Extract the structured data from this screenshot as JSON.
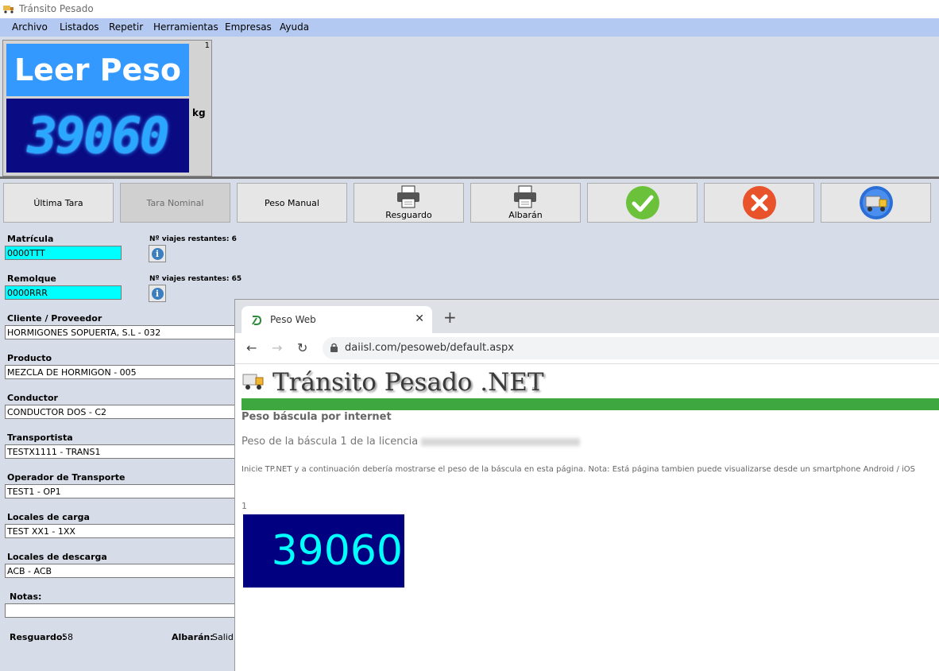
{
  "window": {
    "title": "Tránsito Pesado"
  },
  "menu": [
    "Archivo",
    "Listados",
    "Repetir",
    "Herramientas",
    "Empresas",
    "Ayuda"
  ],
  "scale": {
    "index": "1",
    "button": "Leer Peso",
    "weight": "39060",
    "unit": "kg"
  },
  "toolbar": {
    "ultima_tara": "Última Tara",
    "tara_nominal": "Tara Nominal",
    "peso_manual": "Peso Manual",
    "resguardo": "Resguardo",
    "albaran": "Albarán"
  },
  "form": {
    "matricula": {
      "label": "Matrícula",
      "value": "0000TTT",
      "trips": "Nº viajes restantes: 6"
    },
    "remolque": {
      "label": "Remolque",
      "value": "0000RRR",
      "trips": "Nº viajes restantes: 65"
    },
    "cliente": {
      "label": "Cliente / Proveedor",
      "value": "HORMIGONES SOPUERTA, S.L - 032"
    },
    "producto": {
      "label": "Producto",
      "value": "MEZCLA DE HORMIGON - 005"
    },
    "conductor": {
      "label": "Conductor",
      "value": "CONDUCTOR DOS - C2"
    },
    "transportista": {
      "label": "Transportista",
      "value": "TESTX1111 - TRANS1"
    },
    "operador": {
      "label": "Operador de Transporte",
      "value": "TEST1 - OP1"
    },
    "locales_carga": {
      "label": "Locales de carga",
      "value": "TEST XX1 - 1XX"
    },
    "locales_descarga": {
      "label": "Locales de descarga",
      "value": "ACB - ACB"
    },
    "notas": {
      "label": "Notas:",
      "value": ""
    },
    "resguardo": {
      "label": "Resguardo:",
      "value": "58"
    },
    "albaran": {
      "label": "Albarán:",
      "value": "Salid"
    }
  },
  "browser": {
    "tab_title": "Peso Web",
    "url": "daiisl.com/pesoweb/default.aspx",
    "brand": "Tránsito Pesado .NET",
    "tm": "™",
    "heading": "Peso báscula por internet",
    "subtitle": "Peso de la báscula 1 de la licencia",
    "note": "Inicie TP.NET y a continuación debería mostrarse el peso de la báscula en esta página. Nota: Está página tambien puede visualizarse desde un smartphone Android / iOS",
    "scale_index": "1",
    "weight": "39060"
  },
  "colors": {
    "menubar": "#b3c9f1",
    "leer_button": "#3399ff",
    "display_bg": "#0a0a82",
    "web_display_bg": "#000080",
    "web_digits": "#00ffff",
    "green_bar": "#3fa73f",
    "input_highlight": "#00ffff"
  }
}
